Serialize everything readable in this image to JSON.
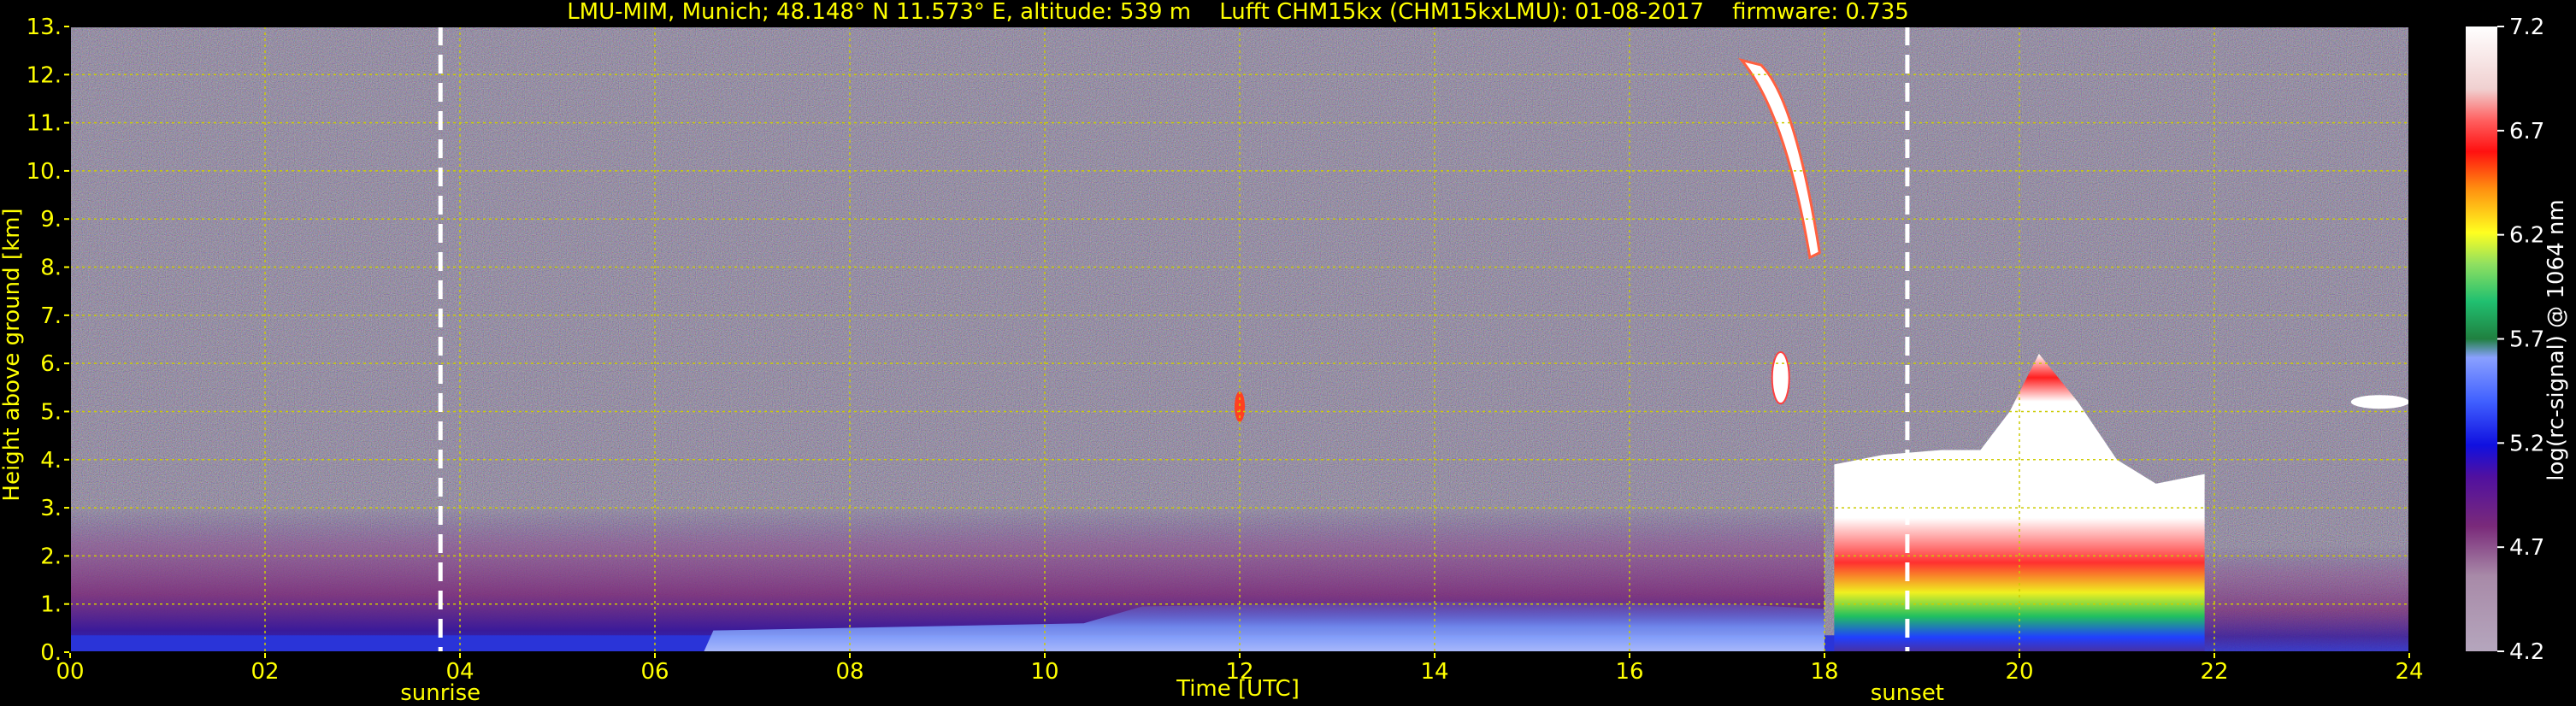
{
  "chart_data": {
    "type": "heatmap",
    "title": "LMU-MIM, Munich; 48.148° N 11.573° E, altitude: 539 m    Lufft CHM15kx (CHM15kxLMU): 01-08-2017    firmware: 0.735",
    "xlabel": "Time [UTC]",
    "ylabel": "Height above ground [km]",
    "xlim": [
      0,
      24
    ],
    "ylim": [
      0,
      13
    ],
    "x_ticks": [
      "00",
      "02",
      "04",
      "06",
      "08",
      "10",
      "12",
      "14",
      "16",
      "18",
      "20",
      "22",
      "24"
    ],
    "y_ticks": [
      "0.",
      "1.",
      "2.",
      "3.",
      "4.",
      "5.",
      "6.",
      "7.",
      "8.",
      "9.",
      "10.",
      "11.",
      "12.",
      "13."
    ],
    "grid": true,
    "events": [
      {
        "label": "sunrise",
        "time": 3.8
      },
      {
        "label": "sunset",
        "time": 18.85
      }
    ],
    "colorbar": {
      "label": "log(rc-signal) @ 1064 nm",
      "range": [
        4.2,
        7.2
      ],
      "ticks": [
        "4.2",
        "4.7",
        "5.2",
        "5.7",
        "6.2",
        "6.7",
        "7.2"
      ]
    },
    "colors": {
      "text": "#ffff00",
      "grid": "#cccc00",
      "background": "#000000",
      "noise": "#6a5a88"
    }
  }
}
